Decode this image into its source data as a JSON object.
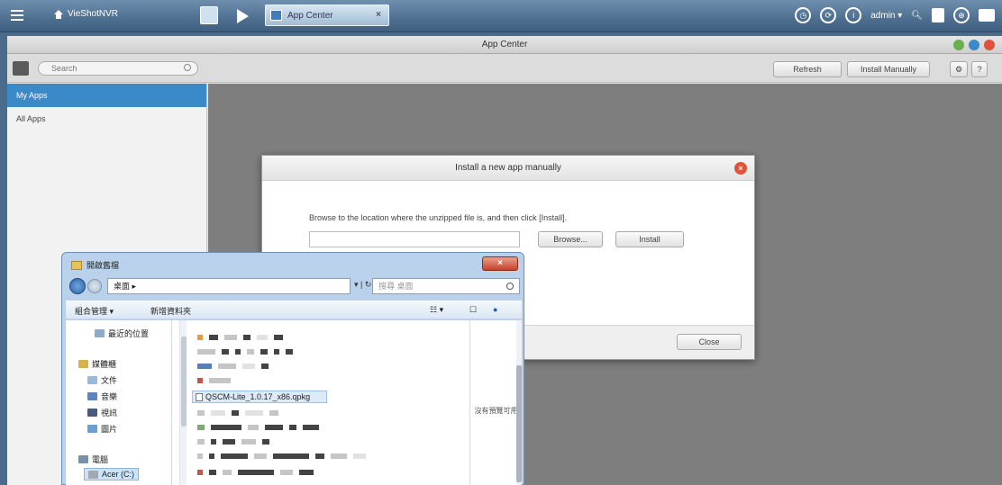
{
  "topbar": {
    "home_label": "VieShotNVR",
    "tab_label": "App Center",
    "tab_close": "×",
    "user_label": "admin ▾"
  },
  "app": {
    "title": "App Center",
    "search_placeholder": "Search",
    "buttons": {
      "refresh": "Refresh",
      "install_manually": "Install Manually",
      "help": "?"
    },
    "sidebar": [
      {
        "label": "My Apps",
        "active": true
      },
      {
        "label": "All Apps",
        "active": false
      }
    ]
  },
  "dialog": {
    "title": "Install a new app manually",
    "message": "Browse to the location where the unzipped file is, and then click [Install].",
    "browse_label": "Browse...",
    "install_label": "Install",
    "close_label": "Close"
  },
  "explorer": {
    "title": "開啟舊檔",
    "path": "桌面 ▸",
    "search_placeholder": "搜尋 桌面",
    "refresh_glyph": "▾ | ↻",
    "toolbar": {
      "organize": "組合管理 ▾",
      "new_folder": "新增資料夾"
    },
    "tree": {
      "recent": "最近的位置",
      "libraries": "媒體櫃",
      "documents": "文件",
      "music": "音樂",
      "videos": "視訊",
      "pictures": "圖片",
      "computer": "電腦",
      "drive": "Acer (C:)"
    },
    "highlighted_file": "QSCM-Lite_1.0.17_x86.qpkg",
    "preview_text": "沒有預覽可用"
  },
  "colors": {
    "accent": "#3a89c9",
    "close_red": "#e0533a",
    "wbtn_green": "#6ab04c",
    "wbtn_blue": "#3a89c9",
    "wbtn_red": "#e0533a"
  }
}
